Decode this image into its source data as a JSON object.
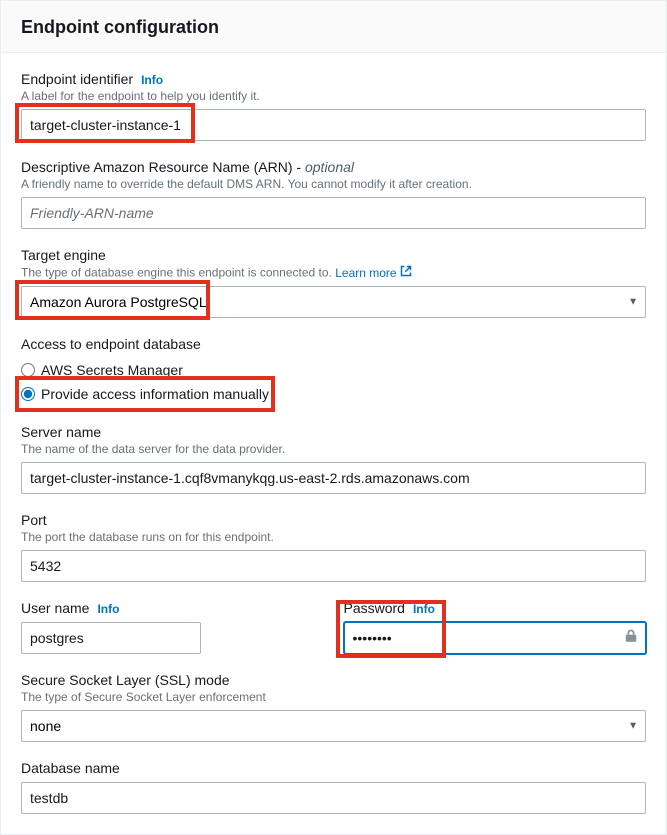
{
  "panel": {
    "title": "Endpoint configuration"
  },
  "endpointIdentifier": {
    "label": "Endpoint identifier",
    "info": "Info",
    "desc": "A label for the endpoint to help you identify it.",
    "value": "target-cluster-instance-1"
  },
  "arn": {
    "label": "Descriptive Amazon Resource Name (ARN) - ",
    "optional": "optional",
    "desc": "A friendly name to override the default DMS ARN. You cannot modify it after creation.",
    "placeholder": "Friendly-ARN-name"
  },
  "targetEngine": {
    "label": "Target engine",
    "desc": "The type of database engine this endpoint is connected to.",
    "learnMore": "Learn more",
    "value": "Amazon Aurora PostgreSQL"
  },
  "access": {
    "label": "Access to endpoint database",
    "options": {
      "secrets": "AWS Secrets Manager",
      "manual": "Provide access information manually"
    }
  },
  "serverName": {
    "label": "Server name",
    "desc": "The name of the data server for the data provider.",
    "value": "target-cluster-instance-1.cqf8vmanykqg.us-east-2.rds.amazonaws.com"
  },
  "port": {
    "label": "Port",
    "desc": "The port the database runs on for this endpoint.",
    "value": "5432"
  },
  "userName": {
    "label": "User name",
    "info": "Info",
    "value": "postgres"
  },
  "password": {
    "label": "Password",
    "info": "Info",
    "value": "••••••••"
  },
  "sslMode": {
    "label": "Secure Socket Layer (SSL) mode",
    "desc": "The type of Secure Socket Layer enforcement",
    "value": "none"
  },
  "databaseName": {
    "label": "Database name",
    "value": "testdb"
  }
}
